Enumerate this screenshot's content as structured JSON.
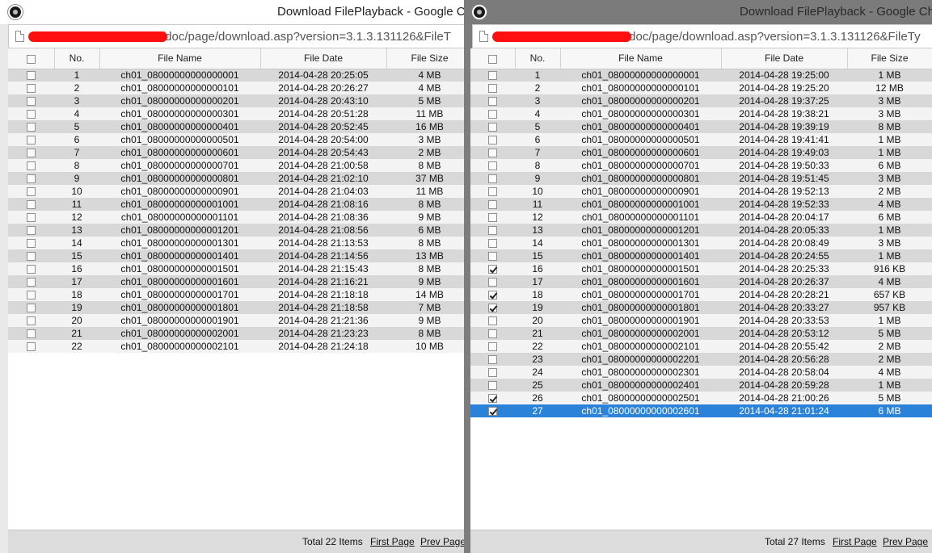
{
  "left": {
    "title": "Download FilePlayback - Google C",
    "url": "/doc/page/download.asp?version=3.1.3.131126&FileT",
    "columns": {
      "no": "No.",
      "name": "File Name",
      "date": "File Date",
      "size": "File Size"
    },
    "rows": [
      {
        "no": "1",
        "name": "ch01_08000000000000001",
        "date": "2014-04-28 20:25:05",
        "size": "4 MB",
        "checked": false
      },
      {
        "no": "2",
        "name": "ch01_08000000000000101",
        "date": "2014-04-28 20:26:27",
        "size": "4 MB",
        "checked": false
      },
      {
        "no": "3",
        "name": "ch01_08000000000000201",
        "date": "2014-04-28 20:43:10",
        "size": "5 MB",
        "checked": false
      },
      {
        "no": "4",
        "name": "ch01_08000000000000301",
        "date": "2014-04-28 20:51:28",
        "size": "11 MB",
        "checked": false
      },
      {
        "no": "5",
        "name": "ch01_08000000000000401",
        "date": "2014-04-28 20:52:45",
        "size": "16 MB",
        "checked": false
      },
      {
        "no": "6",
        "name": "ch01_08000000000000501",
        "date": "2014-04-28 20:54:00",
        "size": "3 MB",
        "checked": false
      },
      {
        "no": "7",
        "name": "ch01_08000000000000601",
        "date": "2014-04-28 20:54:43",
        "size": "2 MB",
        "checked": false
      },
      {
        "no": "8",
        "name": "ch01_08000000000000701",
        "date": "2014-04-28 21:00:58",
        "size": "8 MB",
        "checked": false
      },
      {
        "no": "9",
        "name": "ch01_08000000000000801",
        "date": "2014-04-28 21:02:10",
        "size": "37 MB",
        "checked": false
      },
      {
        "no": "10",
        "name": "ch01_08000000000000901",
        "date": "2014-04-28 21:04:03",
        "size": "11 MB",
        "checked": false
      },
      {
        "no": "11",
        "name": "ch01_08000000000001001",
        "date": "2014-04-28 21:08:16",
        "size": "8 MB",
        "checked": false
      },
      {
        "no": "12",
        "name": "ch01_08000000000001101",
        "date": "2014-04-28 21:08:36",
        "size": "9 MB",
        "checked": false
      },
      {
        "no": "13",
        "name": "ch01_08000000000001201",
        "date": "2014-04-28 21:08:56",
        "size": "6 MB",
        "checked": false
      },
      {
        "no": "14",
        "name": "ch01_08000000000001301",
        "date": "2014-04-28 21:13:53",
        "size": "8 MB",
        "checked": false
      },
      {
        "no": "15",
        "name": "ch01_08000000000001401",
        "date": "2014-04-28 21:14:56",
        "size": "13 MB",
        "checked": false
      },
      {
        "no": "16",
        "name": "ch01_08000000000001501",
        "date": "2014-04-28 21:15:43",
        "size": "8 MB",
        "checked": false
      },
      {
        "no": "17",
        "name": "ch01_08000000000001601",
        "date": "2014-04-28 21:16:21",
        "size": "9 MB",
        "checked": false
      },
      {
        "no": "18",
        "name": "ch01_08000000000001701",
        "date": "2014-04-28 21:18:18",
        "size": "14 MB",
        "checked": false
      },
      {
        "no": "19",
        "name": "ch01_08000000000001801",
        "date": "2014-04-28 21:18:58",
        "size": "7 MB",
        "checked": false
      },
      {
        "no": "20",
        "name": "ch01_08000000000001901",
        "date": "2014-04-28 21:21:36",
        "size": "9 MB",
        "checked": false
      },
      {
        "no": "21",
        "name": "ch01_08000000000002001",
        "date": "2014-04-28 21:23:23",
        "size": "8 MB",
        "checked": false
      },
      {
        "no": "22",
        "name": "ch01_08000000000002101",
        "date": "2014-04-28 21:24:18",
        "size": "10 MB",
        "checked": false
      }
    ],
    "footer": {
      "total": "Total 22 Items",
      "first": "First Page",
      "prev": "Prev Page"
    }
  },
  "right": {
    "title": "Download FilePlayback - Google Ch",
    "url": "/doc/page/download.asp?version=3.1.3.131126&FileTy",
    "columns": {
      "no": "No.",
      "name": "File Name",
      "date": "File Date",
      "size": "File Size"
    },
    "rows": [
      {
        "no": "1",
        "name": "ch01_08000000000000001",
        "date": "2014-04-28 19:25:00",
        "size": "1 MB",
        "checked": false
      },
      {
        "no": "2",
        "name": "ch01_08000000000000101",
        "date": "2014-04-28 19:25:20",
        "size": "12 MB",
        "checked": false
      },
      {
        "no": "3",
        "name": "ch01_08000000000000201",
        "date": "2014-04-28 19:37:25",
        "size": "3 MB",
        "checked": false
      },
      {
        "no": "4",
        "name": "ch01_08000000000000301",
        "date": "2014-04-28 19:38:21",
        "size": "3 MB",
        "checked": false
      },
      {
        "no": "5",
        "name": "ch01_08000000000000401",
        "date": "2014-04-28 19:39:19",
        "size": "8 MB",
        "checked": false
      },
      {
        "no": "6",
        "name": "ch01_08000000000000501",
        "date": "2014-04-28 19:41:41",
        "size": "1 MB",
        "checked": false
      },
      {
        "no": "7",
        "name": "ch01_08000000000000601",
        "date": "2014-04-28 19:49:03",
        "size": "1 MB",
        "checked": false
      },
      {
        "no": "8",
        "name": "ch01_08000000000000701",
        "date": "2014-04-28 19:50:33",
        "size": "6 MB",
        "checked": false
      },
      {
        "no": "9",
        "name": "ch01_08000000000000801",
        "date": "2014-04-28 19:51:45",
        "size": "3 MB",
        "checked": false
      },
      {
        "no": "10",
        "name": "ch01_08000000000000901",
        "date": "2014-04-28 19:52:13",
        "size": "2 MB",
        "checked": false
      },
      {
        "no": "11",
        "name": "ch01_08000000000001001",
        "date": "2014-04-28 19:52:33",
        "size": "4 MB",
        "checked": false
      },
      {
        "no": "12",
        "name": "ch01_08000000000001101",
        "date": "2014-04-28 20:04:17",
        "size": "6 MB",
        "checked": false
      },
      {
        "no": "13",
        "name": "ch01_08000000000001201",
        "date": "2014-04-28 20:05:33",
        "size": "1 MB",
        "checked": false
      },
      {
        "no": "14",
        "name": "ch01_08000000000001301",
        "date": "2014-04-28 20:08:49",
        "size": "3 MB",
        "checked": false
      },
      {
        "no": "15",
        "name": "ch01_08000000000001401",
        "date": "2014-04-28 20:24:55",
        "size": "1 MB",
        "checked": false
      },
      {
        "no": "16",
        "name": "ch01_08000000000001501",
        "date": "2014-04-28 20:25:33",
        "size": "916 KB",
        "checked": true
      },
      {
        "no": "17",
        "name": "ch01_08000000000001601",
        "date": "2014-04-28 20:26:37",
        "size": "4 MB",
        "checked": false
      },
      {
        "no": "18",
        "name": "ch01_08000000000001701",
        "date": "2014-04-28 20:28:21",
        "size": "657 KB",
        "checked": true
      },
      {
        "no": "19",
        "name": "ch01_08000000000001801",
        "date": "2014-04-28 20:33:27",
        "size": "957 KB",
        "checked": true
      },
      {
        "no": "20",
        "name": "ch01_08000000000001901",
        "date": "2014-04-28 20:33:53",
        "size": "1 MB",
        "checked": false
      },
      {
        "no": "21",
        "name": "ch01_08000000000002001",
        "date": "2014-04-28 20:53:12",
        "size": "5 MB",
        "checked": false
      },
      {
        "no": "22",
        "name": "ch01_08000000000002101",
        "date": "2014-04-28 20:55:42",
        "size": "2 MB",
        "checked": false
      },
      {
        "no": "23",
        "name": "ch01_08000000000002201",
        "date": "2014-04-28 20:56:28",
        "size": "2 MB",
        "checked": false
      },
      {
        "no": "24",
        "name": "ch01_08000000000002301",
        "date": "2014-04-28 20:58:04",
        "size": "4 MB",
        "checked": false
      },
      {
        "no": "25",
        "name": "ch01_08000000000002401",
        "date": "2014-04-28 20:59:28",
        "size": "1 MB",
        "checked": false
      },
      {
        "no": "26",
        "name": "ch01_08000000000002501",
        "date": "2014-04-28 21:00:26",
        "size": "5 MB",
        "checked": true
      },
      {
        "no": "27",
        "name": "ch01_08000000000002601",
        "date": "2014-04-28 21:01:24",
        "size": "6 MB",
        "checked": true,
        "selected": true
      }
    ],
    "footer": {
      "total": "Total 27 Items",
      "first": "First Page",
      "prev": "Prev Page"
    }
  },
  "colors": {
    "selected_row": "#2a83d8",
    "redaction": "#ff1010",
    "inactive_titlebar": "#7b7b7b"
  }
}
